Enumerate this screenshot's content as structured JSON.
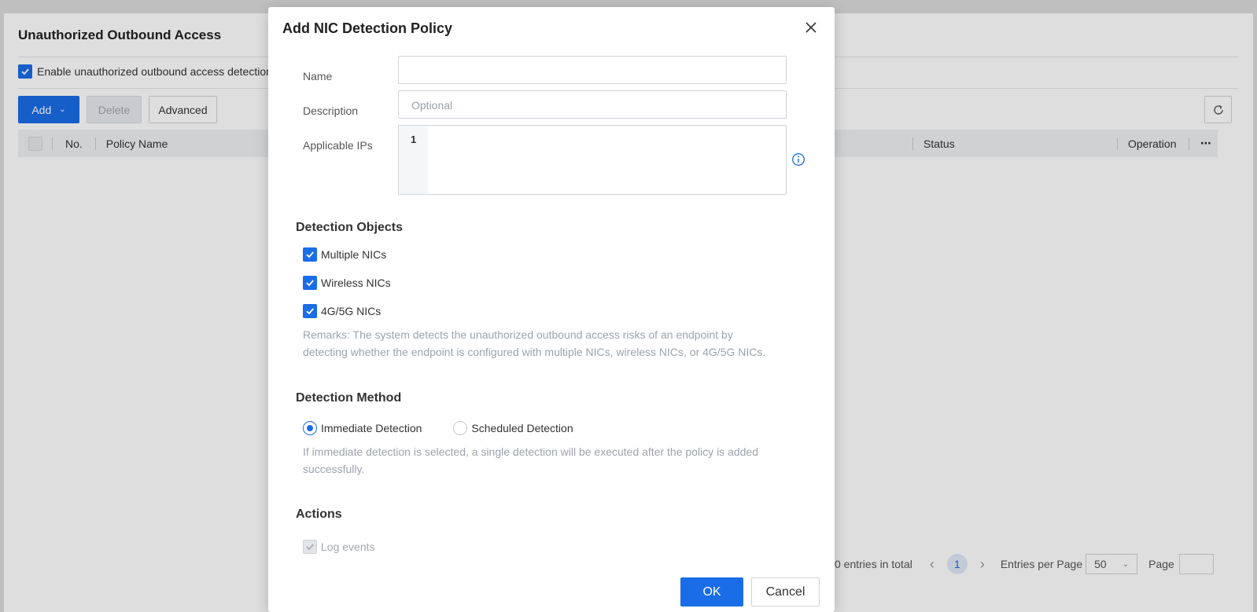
{
  "page": {
    "title": "Unauthorized Outbound Access",
    "enable_label": "Enable unauthorized outbound access detection",
    "toolbar": {
      "add_label": "Add",
      "delete_label": "Delete",
      "advanced_label": "Advanced"
    },
    "table": {
      "columns": [
        "No.",
        "Policy Name",
        "Status",
        "Operation"
      ],
      "more": "⋯"
    },
    "pagination": {
      "total": "0 entries in total",
      "current_page": "1",
      "entries_label": "Entries per Page",
      "entries_value": "50",
      "page_label": "Page",
      "prev": "‹",
      "next": "›"
    }
  },
  "modal": {
    "title": "Add NIC Detection Policy",
    "fields": {
      "name_label": "Name",
      "name_value": "",
      "description_label": "Description",
      "description_placeholder": "Optional",
      "ips_label": "Applicable IPs",
      "ips_line_number": "1"
    },
    "detection_objects": {
      "title": "Detection Objects",
      "options": [
        "Multiple NICs",
        "Wireless NICs",
        "4G/5G NICs"
      ],
      "remarks": "Remarks: The system detects the unauthorized outbound access risks of an endpoint by detecting whether the endpoint is configured with multiple NICs, wireless NICs, or 4G/5G NICs."
    },
    "detection_method": {
      "title": "Detection Method",
      "immediate": "Immediate Detection",
      "scheduled": "Scheduled Detection",
      "selected": "Immediate Detection",
      "hint": "If immediate detection is selected, a single detection will be executed after the policy is added successfully."
    },
    "actions": {
      "title": "Actions",
      "log_events": "Log events"
    },
    "ok_label": "OK",
    "cancel_label": "Cancel"
  },
  "colors": {
    "accent": "#1a6de6",
    "hint_text": "#9ca3ab"
  }
}
